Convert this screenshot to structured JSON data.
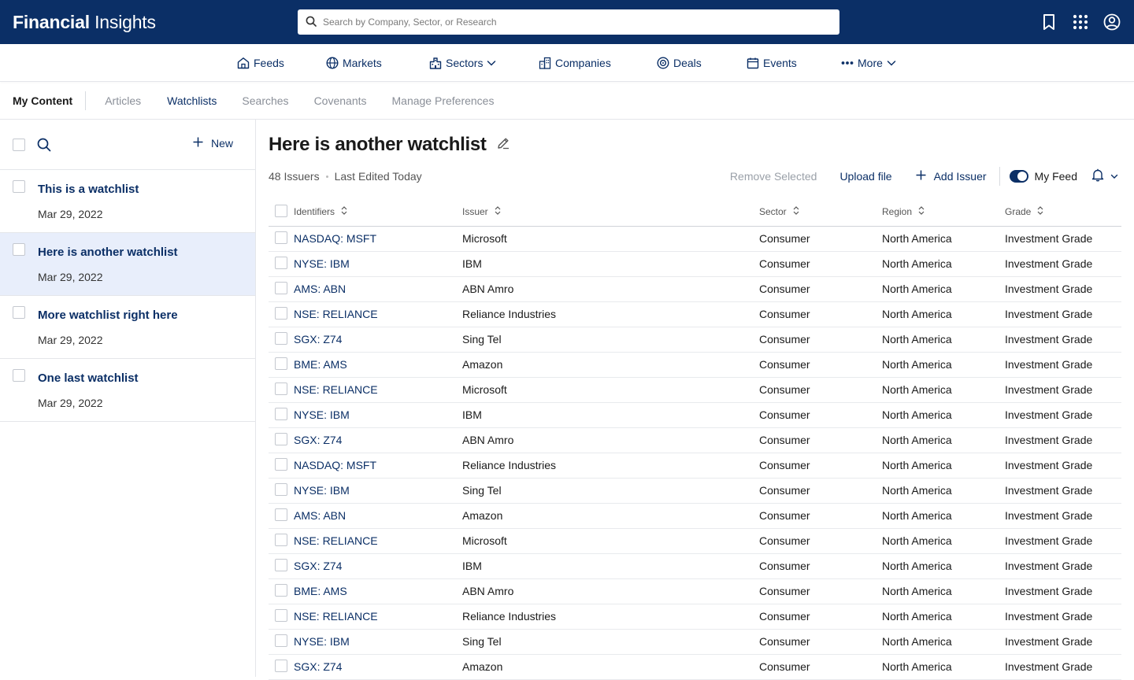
{
  "header": {
    "brand_bold": "Financial",
    "brand_regular": "Insights",
    "search_placeholder": "Search by Company, Sector, or Research"
  },
  "icons": {
    "bookmark": "bookmark-icon",
    "apps": "apps-grid-icon",
    "account": "account-circle-icon"
  },
  "nav": {
    "feeds": "Feeds",
    "markets": "Markets",
    "sectors": "Sectors",
    "companies": "Companies",
    "deals": "Deals",
    "events": "Events",
    "more": "More"
  },
  "subnav": {
    "my_content": "My Content",
    "articles": "Articles",
    "watchlists": "Watchlists",
    "searches": "Searches",
    "covenants": "Covenants",
    "preferences": "Manage Preferences"
  },
  "sidebar": {
    "new_label": "New",
    "items": [
      {
        "title": "This is a watchlist",
        "date": "Mar 29, 2022"
      },
      {
        "title": "Here is another watchlist",
        "date": "Mar 29, 2022"
      },
      {
        "title": "More watchlist right here",
        "date": "Mar 29, 2022"
      },
      {
        "title": "One last watchlist",
        "date": "Mar 29, 2022"
      }
    ]
  },
  "watchlist": {
    "title": "Here is another watchlist",
    "count": "48 Issuers",
    "edited": "Last Edited Today",
    "remove_selected": "Remove Selected",
    "upload_file": "Upload file",
    "add_issuer": "Add Issuer",
    "my_feed": "My Feed"
  },
  "colors": {
    "primary": "#0b2f66",
    "selected_row": "#e8eefb"
  },
  "table": {
    "headers": {
      "identifiers": "Identifiers",
      "issuer": "Issuer",
      "sector": "Sector",
      "region": "Region",
      "grade": "Grade"
    },
    "rows": [
      {
        "id": "NASDAQ: MSFT",
        "issuer": "Microsoft",
        "sector": "Consumer",
        "region": "North America",
        "grade": "Investment Grade"
      },
      {
        "id": "NYSE: IBM",
        "issuer": "IBM",
        "sector": "Consumer",
        "region": "North America",
        "grade": "Investment Grade"
      },
      {
        "id": "AMS: ABN",
        "issuer": "ABN Amro",
        "sector": "Consumer",
        "region": "North America",
        "grade": "Investment Grade"
      },
      {
        "id": "NSE: RELIANCE",
        "issuer": "Reliance Industries",
        "sector": "Consumer",
        "region": "North America",
        "grade": "Investment Grade"
      },
      {
        "id": "SGX: Z74",
        "issuer": "Sing Tel",
        "sector": "Consumer",
        "region": "North America",
        "grade": "Investment Grade"
      },
      {
        "id": "BME: AMS",
        "issuer": "Amazon",
        "sector": "Consumer",
        "region": "North America",
        "grade": "Investment Grade"
      },
      {
        "id": "NSE: RELIANCE",
        "issuer": "Microsoft",
        "sector": "Consumer",
        "region": "North America",
        "grade": "Investment Grade"
      },
      {
        "id": "NYSE: IBM",
        "issuer": "IBM",
        "sector": "Consumer",
        "region": "North America",
        "grade": "Investment Grade"
      },
      {
        "id": "SGX: Z74",
        "issuer": "ABN Amro",
        "sector": "Consumer",
        "region": "North America",
        "grade": "Investment Grade"
      },
      {
        "id": "NASDAQ: MSFT",
        "issuer": "Reliance Industries",
        "sector": "Consumer",
        "region": "North America",
        "grade": "Investment Grade"
      },
      {
        "id": "NYSE: IBM",
        "issuer": "Sing Tel",
        "sector": "Consumer",
        "region": "North America",
        "grade": "Investment Grade"
      },
      {
        "id": "AMS: ABN",
        "issuer": "Amazon",
        "sector": "Consumer",
        "region": "North America",
        "grade": "Investment Grade"
      },
      {
        "id": "NSE: RELIANCE",
        "issuer": "Microsoft",
        "sector": "Consumer",
        "region": "North America",
        "grade": "Investment Grade"
      },
      {
        "id": "SGX: Z74",
        "issuer": "IBM",
        "sector": "Consumer",
        "region": "North America",
        "grade": "Investment Grade"
      },
      {
        "id": "BME: AMS",
        "issuer": "ABN Amro",
        "sector": "Consumer",
        "region": "North America",
        "grade": "Investment Grade"
      },
      {
        "id": "NSE: RELIANCE",
        "issuer": "Reliance Industries",
        "sector": "Consumer",
        "region": "North America",
        "grade": "Investment Grade"
      },
      {
        "id": "NYSE: IBM",
        "issuer": "Sing Tel",
        "sector": "Consumer",
        "region": "North America",
        "grade": "Investment Grade"
      },
      {
        "id": "SGX: Z74",
        "issuer": "Amazon",
        "sector": "Consumer",
        "region": "North America",
        "grade": "Investment Grade"
      }
    ]
  }
}
